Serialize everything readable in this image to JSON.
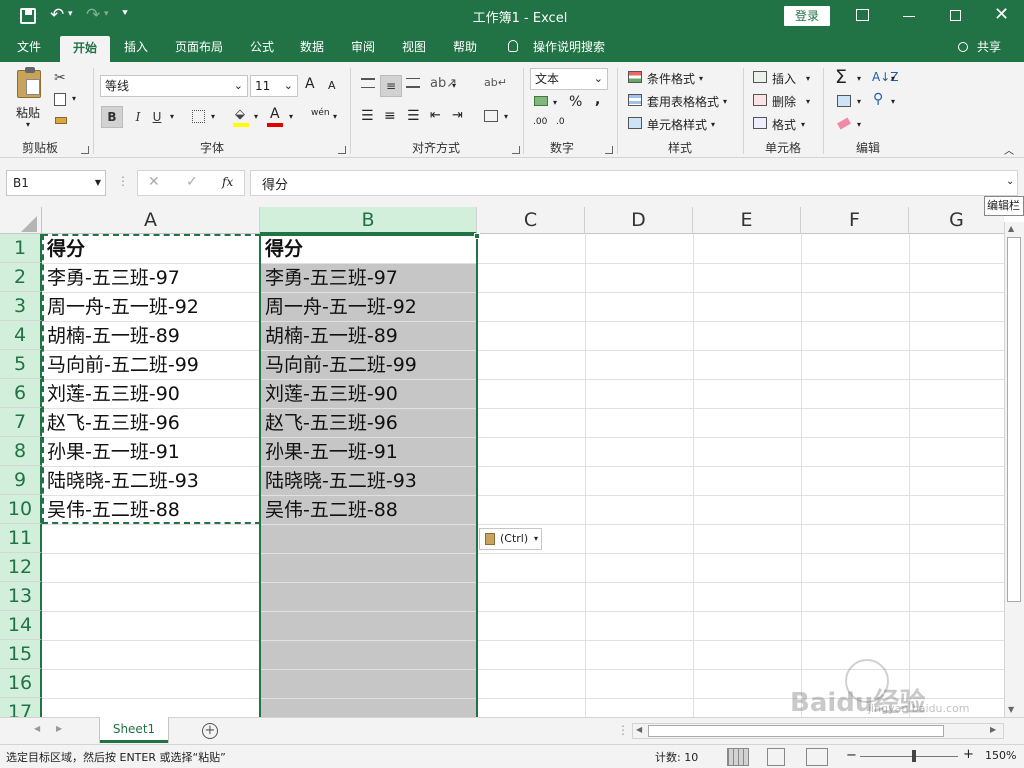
{
  "window": {
    "title": "工作簿1  -  Excel",
    "login_label": "登录"
  },
  "ribbon_tabs": [
    {
      "label": "文件"
    },
    {
      "label": "开始"
    },
    {
      "label": "插入"
    },
    {
      "label": "页面布局"
    },
    {
      "label": "公式"
    },
    {
      "label": "数据"
    },
    {
      "label": "审阅"
    },
    {
      "label": "视图"
    },
    {
      "label": "帮助"
    },
    {
      "label": "操作说明搜索"
    }
  ],
  "share_label": "共享",
  "clipboard": {
    "paste_label": "粘贴",
    "group_label": "剪贴板"
  },
  "font": {
    "name": "等线",
    "size": "11",
    "group_label": "字体",
    "bold": "B",
    "italic": "I",
    "underline": "U",
    "grow": "A",
    "shrink": "A",
    "font_color_glyph": "A",
    "phonetic": "wén"
  },
  "alignment": {
    "group_label": "对齐方式"
  },
  "number": {
    "format": "文本",
    "group_label": "数字",
    "percent": "%",
    "comma": ",",
    "inc_dec": ".00",
    "dec_dec": ".0"
  },
  "styles": {
    "group_label": "样式",
    "cond_format": "条件格式",
    "table_format": "套用表格格式",
    "cell_styles": "单元格样式"
  },
  "cells_group": {
    "group_label": "单元格",
    "insert": "插入",
    "delete": "删除",
    "format": "格式"
  },
  "editing": {
    "group_label": "编辑",
    "sum": "Σ"
  },
  "formula_bar": {
    "name_box": "B1",
    "fx": "fx",
    "content": "得分",
    "tooltip": "编辑栏"
  },
  "columns": [
    "A",
    "B",
    "C",
    "D",
    "E",
    "F",
    "G"
  ],
  "rows": [
    "1",
    "2",
    "3",
    "4",
    "5",
    "6",
    "7",
    "8",
    "9",
    "10",
    "11",
    "12",
    "13",
    "14",
    "15",
    "16",
    "17"
  ],
  "cells": {
    "A": [
      "得分",
      "李勇-五三班-97",
      "周一舟-五一班-92",
      "胡楠-五一班-89",
      "马向前-五二班-99",
      "刘莲-五三班-90",
      "赵飞-五三班-96",
      "孙果-五一班-91",
      "陆晓晓-五二班-93",
      "吴伟-五二班-88"
    ],
    "B": [
      "得分",
      "李勇-五三班-97",
      "周一舟-五一班-92",
      "胡楠-五一班-89",
      "马向前-五二班-99",
      "刘莲-五三班-90",
      "赵飞-五三班-96",
      "孙果-五一班-91",
      "陆晓晓-五二班-93",
      "吴伟-五二班-88"
    ]
  },
  "paste_options": "(Ctrl)",
  "sheet_tab": "Sheet1",
  "status": {
    "message": "选定目标区域，然后按 ENTER 或选择“粘贴”",
    "count": "计数: 10",
    "zoom": "150%",
    "minus": "−",
    "plus": "+"
  },
  "watermark": {
    "brand": "Baidu经验",
    "url": "jingyan.baidu.com"
  },
  "colors": {
    "accent": "#217346",
    "selected_fill": "#c6c6c6",
    "header_selected": "#d2efdc"
  }
}
